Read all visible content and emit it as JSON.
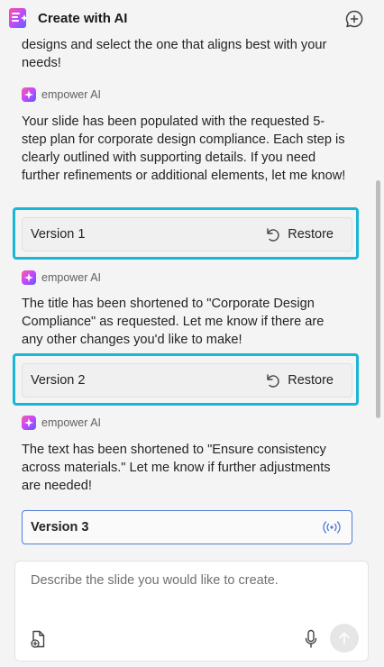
{
  "header": {
    "title": "Create with AI",
    "logo_icon": "create-ai-logo-icon",
    "new_chat_icon": "add-chat-icon"
  },
  "messages": [
    {
      "type": "ai-text-partial",
      "text": "designs and select the one that aligns best with your needs!"
    },
    {
      "sender": "empower AI",
      "text": "Your slide has been populated with the requested 5-step plan for corporate design compliance. Each step is clearly outlined with supporting details. If you need further refinements or additional elements, let me know!",
      "version": {
        "label": "Version 1",
        "action": "Restore"
      }
    },
    {
      "sender": "empower AI",
      "text": "The title has been shortened to \"Corporate Design Compliance\" as requested. Let me know if there are any other changes you'd like to make!",
      "version": {
        "label": "Version 2",
        "action": "Restore"
      }
    },
    {
      "sender": "empower AI",
      "text": "The text has been shortened to \"Ensure consistency across materials.\" Let me know if further adjustments are needed!",
      "version": {
        "label": "Version 3",
        "current": true
      }
    }
  ],
  "composer": {
    "placeholder": "Describe the slide you would like to create.",
    "value": ""
  },
  "colors": {
    "highlight": "#19b6d6",
    "current_version_border": "#4f7cd8",
    "ai_accent": "#c248ff"
  }
}
